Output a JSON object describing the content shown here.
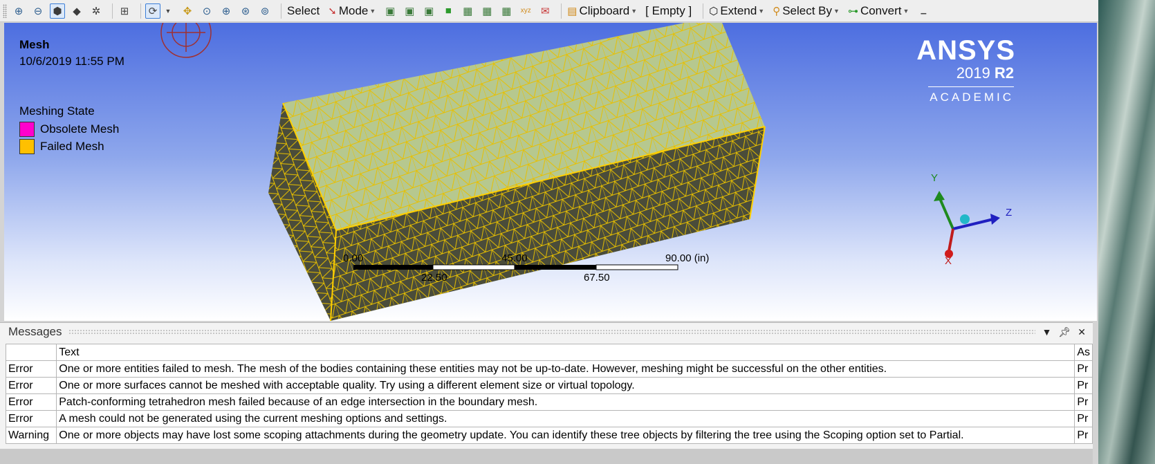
{
  "toolbar": {
    "select_label": "Select",
    "mode_label": "Mode",
    "clipboard_label": "Clipboard",
    "empty_label": "[ Empty ]",
    "extend_label": "Extend",
    "select_by_label": "Select By",
    "convert_label": "Convert"
  },
  "viewport": {
    "title": "Mesh",
    "date": "10/6/2019 11:55 PM",
    "legend_title": "Meshing State",
    "legend": [
      {
        "label": "Obsolete Mesh",
        "color": "#ff00cc"
      },
      {
        "label": "Failed Mesh",
        "color": "#ffc000"
      }
    ],
    "brand_name": "ANSYS",
    "brand_year": "2019",
    "brand_release": "R2",
    "brand_edition": "ACADEMIC",
    "scale_labels": [
      "0.00",
      "22.50",
      "45.00",
      "67.50",
      "90.00 (in)"
    ],
    "triad": {
      "y": "Y",
      "z": "Z",
      "x": "X"
    }
  },
  "messages": {
    "title": "Messages",
    "columns": {
      "type": "",
      "text": "Text",
      "association": "As"
    },
    "rows": [
      {
        "type": "Error",
        "text": "One or more entities failed to mesh. The mesh of the bodies containing these entities may not be up-to-date.  However, meshing might be successful on the other entities.",
        "association": "Pr"
      },
      {
        "type": "Error",
        "text": "One or more surfaces cannot be meshed with acceptable quality. Try using a different element size or virtual topology.",
        "association": "Pr"
      },
      {
        "type": "Error",
        "text": "Patch-conforming tetrahedron mesh failed because of an edge intersection in the boundary mesh.",
        "association": "Pr"
      },
      {
        "type": "Error",
        "text": "A mesh could not be generated using the current meshing options and settings.",
        "association": "Pr"
      },
      {
        "type": "Warning",
        "text": "One or more objects may have lost some scoping attachments during the geometry update. You can identify these tree objects by filtering the tree using the Scoping option set to Partial.",
        "association": "Pr"
      }
    ]
  },
  "colors": {
    "mesh_line": "#e8c000",
    "top_face": "#b6c88f",
    "side_face": "#4a4c3a",
    "viewport_top": "#4d6ee0"
  }
}
